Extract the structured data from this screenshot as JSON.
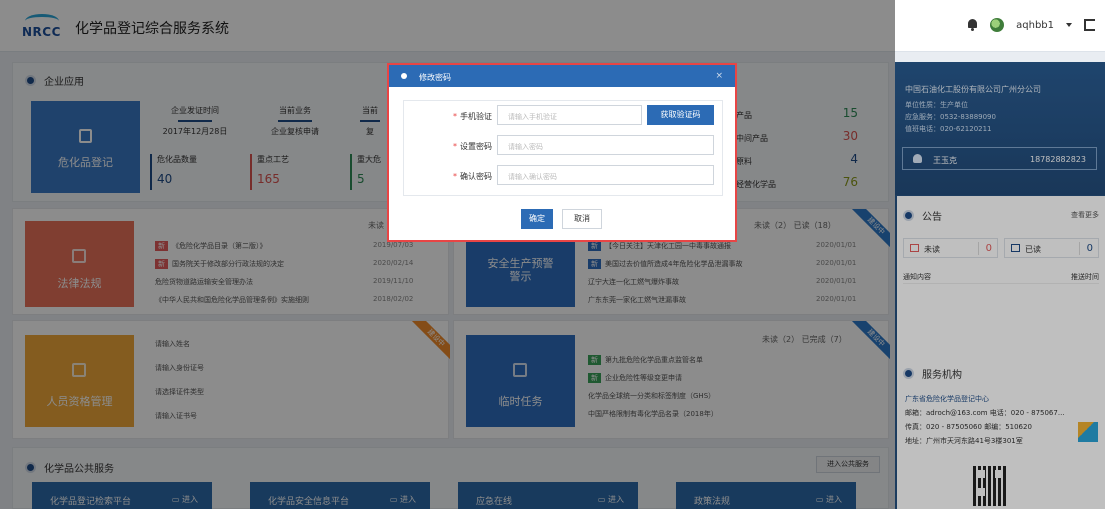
{
  "header": {
    "logo_text": "NRCC",
    "title": "化学品登记综合服务系统",
    "username": "aqhbb1"
  },
  "enterprise": {
    "title": "企业应用",
    "weihua_label": "危化品登记",
    "stats": [
      {
        "label": "企业发证时间",
        "value": "2017年12月28日"
      },
      {
        "label": "当前业务",
        "value": "企业复核申请"
      },
      {
        "label": "当前",
        "value": "复"
      }
    ],
    "kpis": [
      {
        "label": "危化品数量",
        "value": "40",
        "color": "#333333"
      },
      {
        "label": "重点工艺",
        "value": "165",
        "color": "#d9534f"
      },
      {
        "label": "重大危",
        "value": "5",
        "color": "#2e8b57"
      }
    ],
    "right_items": [
      {
        "label": "产品",
        "value": "15",
        "color": "#2e8b57"
      },
      {
        "label": "中间产品",
        "value": "30",
        "color": "#d9534f"
      },
      {
        "label": "原料",
        "value": "4",
        "color": "#1e4b87"
      },
      {
        "label": "经营化学品",
        "value": "76",
        "color": "#8a9a1a"
      }
    ]
  },
  "cards": {
    "law": {
      "label": "法律法规",
      "tabs": "未读（7）",
      "items": [
        {
          "tag": "新",
          "text": "《危险化学品目录（第二版）》",
          "date": "2019/07/03"
        },
        {
          "tag": "新",
          "text": "国务院关于修改部分行政法规的决定",
          "date": "2020/02/14"
        },
        {
          "tag": "",
          "text": "危险货物道路运输安全管理办法",
          "date": "2019/11/10"
        },
        {
          "tag": "",
          "text": "《中华人民共和国危险化学品管理条例》实施细则",
          "date": "2018/02/02"
        }
      ]
    },
    "safety": {
      "label": "安全生产预警警示",
      "tabs": "未读（2） 已读（18）",
      "ribbon": "建设中",
      "items": [
        {
          "tag": "新",
          "text": "【今日关注】天津化工园一中毒事故通报",
          "date": "2020/01/01"
        },
        {
          "tag": "新",
          "text": "美国过去价值所造成4年危险化学品泄漏事故",
          "date": "2020/01/01"
        },
        {
          "tag": "",
          "text": "辽宁大连一化工燃气爆炸事故",
          "date": "2020/01/01"
        },
        {
          "tag": "",
          "text": "广东东莞一家化工燃气泄漏事故",
          "date": "2020/01/01"
        }
      ]
    },
    "people": {
      "label": "人员资格管理",
      "ribbon": "建设中",
      "fields": [
        "请输入姓名",
        "请输入身份证号",
        "请选择证件类型",
        "请输入证书号"
      ]
    },
    "task": {
      "label": "临时任务",
      "tabs": "未读（2） 已完成（7）",
      "ribbon": "建设中",
      "items": [
        {
          "tag": "新",
          "text": "第九批危险化学品重点监管名单"
        },
        {
          "tag": "新",
          "text": "企业危险性等级变更申请"
        },
        {
          "tag": "",
          "text": "化学品全球统一分类和标签制度（GHS）"
        },
        {
          "tag": "",
          "text": "中国严格限制有毒化学品名录（2018年）"
        }
      ]
    }
  },
  "public": {
    "title": "化学品公共服务",
    "enter_label": "进入公共服务",
    "tiles": [
      {
        "name": "化学品登记检索平台",
        "go": "进入"
      },
      {
        "name": "化学品安全信息平台",
        "go": "进入"
      },
      {
        "name": "应急在线",
        "go": "进入"
      },
      {
        "name": "政策法规",
        "go": "进入"
      }
    ]
  },
  "sidebar": {
    "company": "中国石油化工股份有限公司广州分公司",
    "lines": [
      "单位性质：生产单位",
      "应急服务：0532-83889090",
      "值班电话：020-62120211"
    ],
    "user_name": "王玉克",
    "user_phone": "18782882823",
    "notice_title": "公告",
    "notice_more": "查看更多",
    "unread_label": "未读",
    "unread_count": "0",
    "read_label": "已读",
    "read_count": "0",
    "col_content": "通知内容",
    "col_time": "推送时间",
    "org_title": "服务机构",
    "org_name": "广东省危险化学品登记中心",
    "org_lines": [
      "邮箱：adroch@163.com    电话：020 - 875067...",
      "传真：020 - 87505060    邮编：510620",
      "地址：广州市天河东路41号3楼301室"
    ]
  },
  "modal": {
    "title": "修改密码",
    "close": "×",
    "fields": [
      {
        "label": "手机验证",
        "placeholder": "请输入手机验证"
      },
      {
        "label": "设置密码",
        "placeholder": "请输入密码"
      },
      {
        "label": "确认密码",
        "placeholder": "请输入确认密码"
      }
    ],
    "code_btn": "获取验证码",
    "ok": "确定",
    "cancel": "取消"
  }
}
